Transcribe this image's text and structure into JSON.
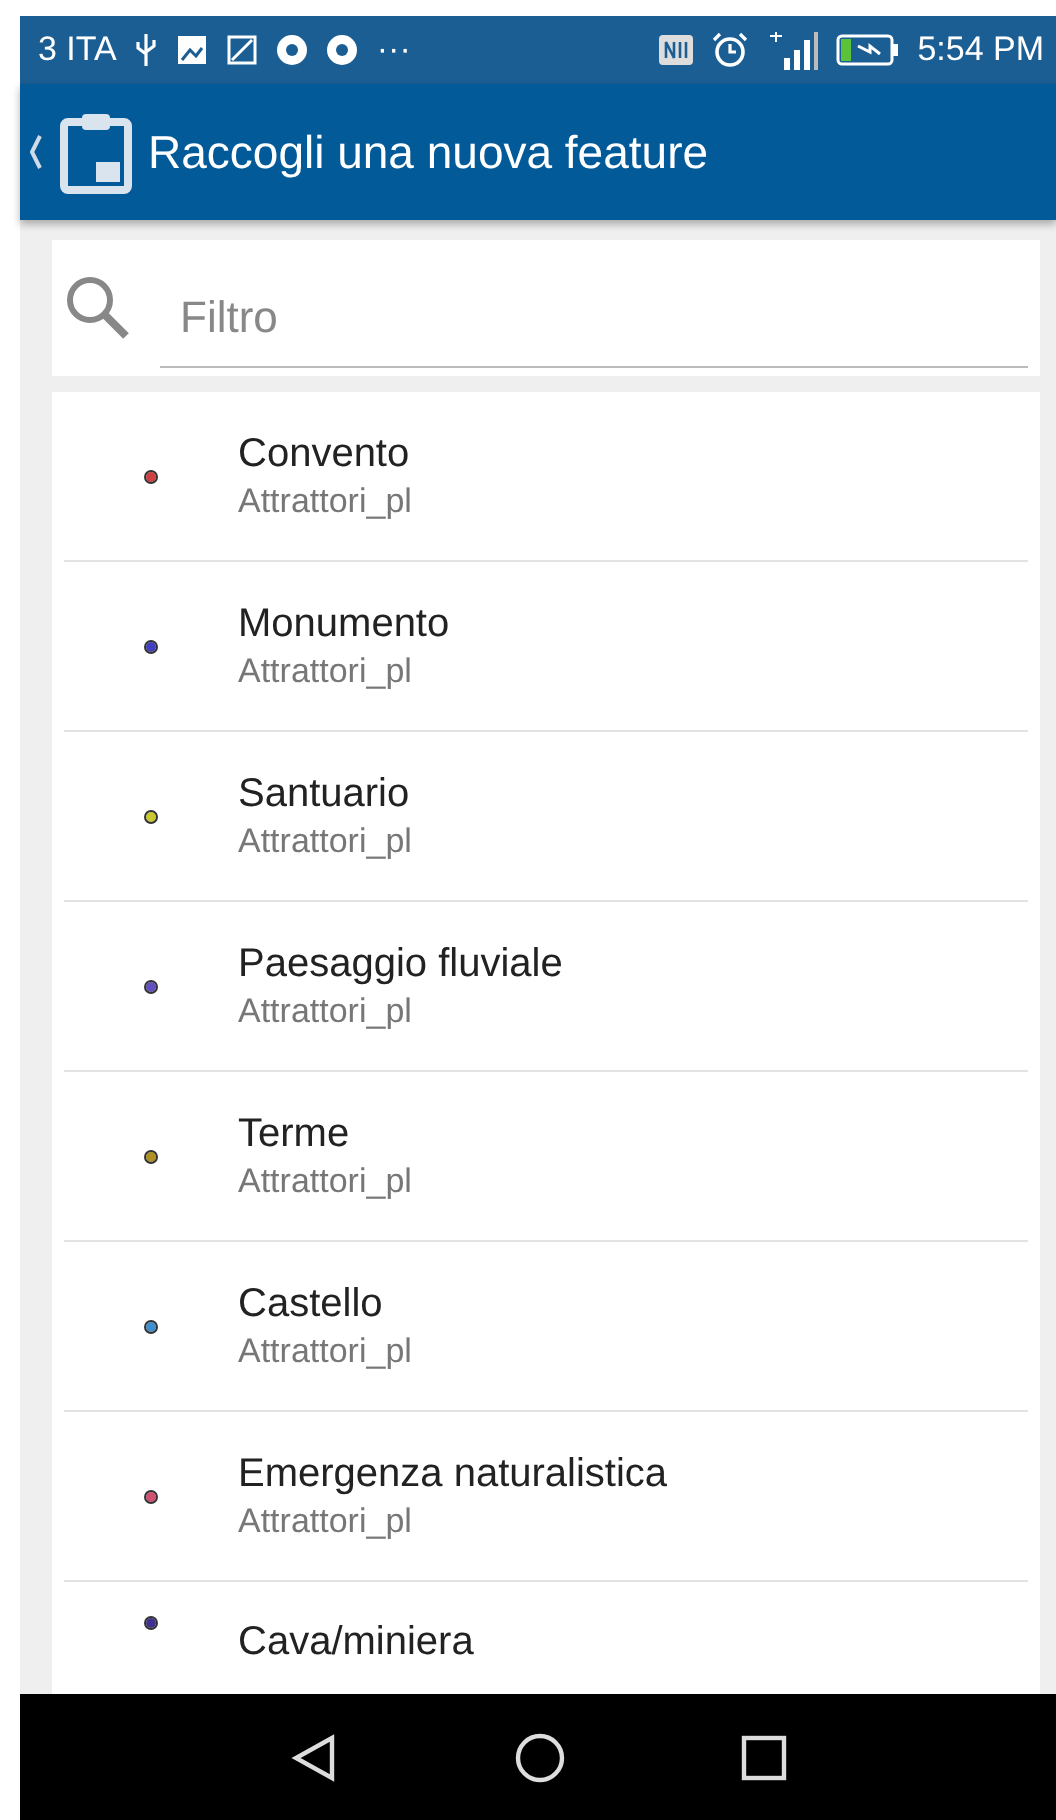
{
  "status_bar": {
    "carrier": "3 ITA",
    "more": "···",
    "time": "5:54 PM"
  },
  "app_bar": {
    "title": "Raccogli una nuova feature"
  },
  "search": {
    "placeholder": "Filtro"
  },
  "features": [
    {
      "name": "Convento",
      "layer": "Attrattori_pl",
      "color": "#d04040"
    },
    {
      "name": "Monumento",
      "layer": "Attrattori_pl",
      "color": "#4040c0"
    },
    {
      "name": "Santuario",
      "layer": "Attrattori_pl",
      "color": "#c8c830"
    },
    {
      "name": "Paesaggio fluviale",
      "layer": "Attrattori_pl",
      "color": "#6050c0"
    },
    {
      "name": "Terme",
      "layer": "Attrattori_pl",
      "color": "#b09020"
    },
    {
      "name": "Castello",
      "layer": "Attrattori_pl",
      "color": "#4090d0"
    },
    {
      "name": "Emergenza naturalistica",
      "layer": "Attrattori_pl",
      "color": "#d05070"
    },
    {
      "name": "Cava/miniera",
      "color": "#403090"
    }
  ]
}
